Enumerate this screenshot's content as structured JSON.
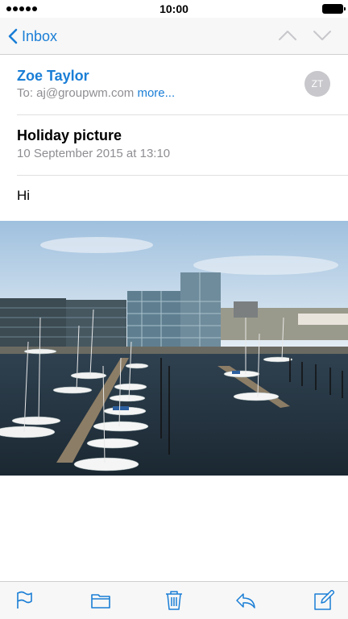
{
  "status_bar": {
    "time": "10:00",
    "signal_icon": "signal-dots-icon",
    "battery_icon": "battery-icon"
  },
  "nav": {
    "back_label": "Inbox",
    "back_icon": "chevron-left-icon",
    "prev_icon": "chevron-up-icon",
    "next_icon": "chevron-down-icon"
  },
  "message": {
    "sender": "Zoe Taylor",
    "to_prefix": "To: aj@groupwm.com ",
    "more_label": "more...",
    "avatar_initials": "ZT",
    "subject": "Holiday picture",
    "date": "10 September 2015 at 13:10",
    "body": "Hi",
    "attachment": "harbour-photo"
  },
  "toolbar": {
    "items": [
      "flag-icon",
      "folder-icon",
      "trash-icon",
      "reply-icon",
      "compose-icon"
    ]
  },
  "colors": {
    "accent": "#1a7ed6",
    "secondary_text": "#8e8e93",
    "bar_background": "#f7f7f7"
  }
}
